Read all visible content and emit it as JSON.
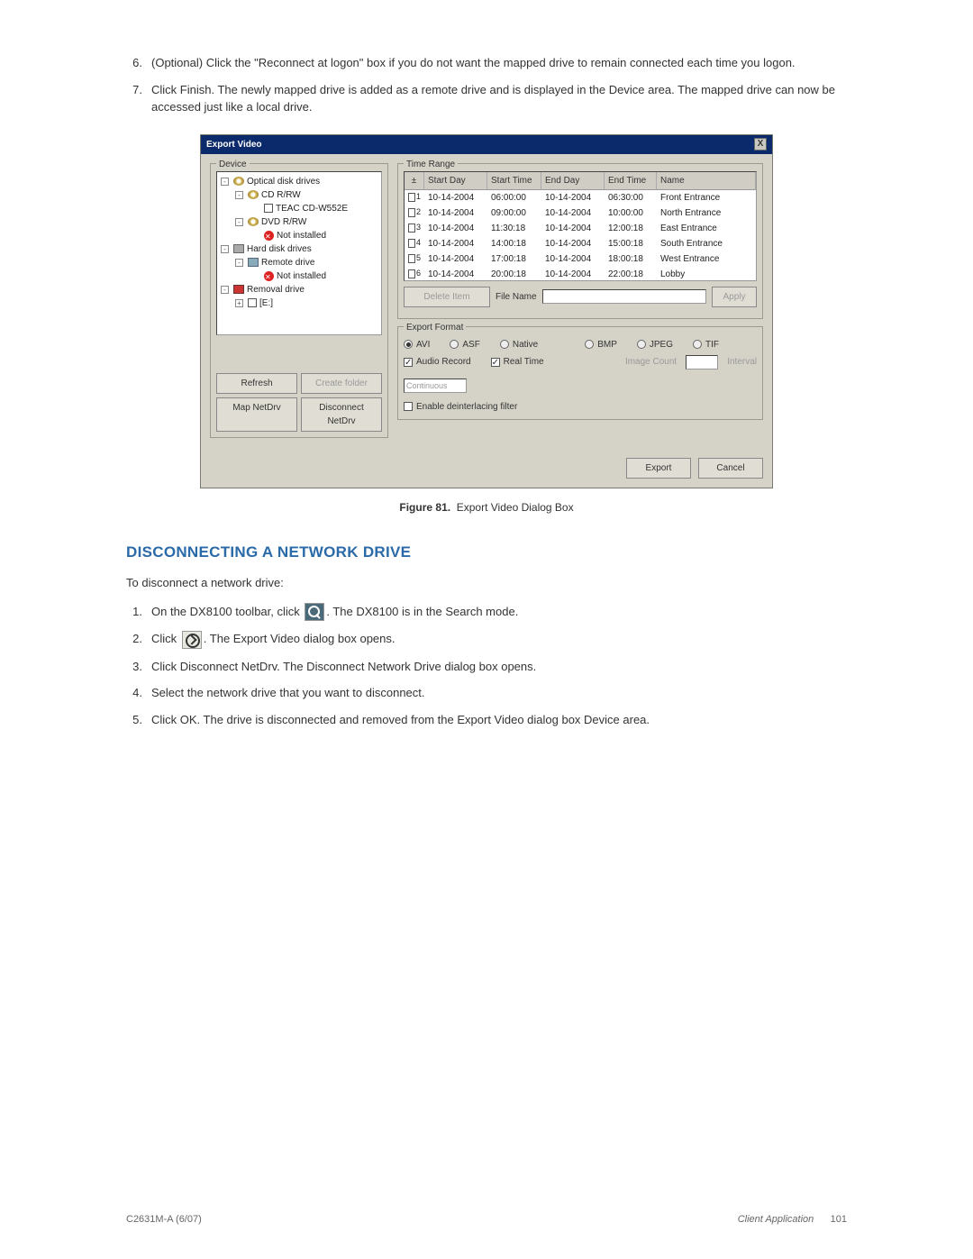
{
  "steps_top": [
    {
      "num": "6.",
      "text": "(Optional) Click the \"Reconnect at logon\" box if you do not want the mapped drive to remain connected each time you logon."
    },
    {
      "num": "7.",
      "text": "Click Finish. The newly mapped drive is added as a remote drive and is displayed in the Device area. The mapped drive can now be accessed just like a local drive."
    }
  ],
  "dialog": {
    "title": "Export Video",
    "device": {
      "legend": "Device",
      "tree": [
        {
          "indent": 0,
          "pm": "-",
          "icon": "cd",
          "label": "Optical disk drives"
        },
        {
          "indent": 1,
          "pm": "-",
          "icon": "cd",
          "label": "CD R/RW"
        },
        {
          "indent": 2,
          "pm": "",
          "icon": "stop",
          "label": "TEAC    CD-W552E"
        },
        {
          "indent": 1,
          "pm": "-",
          "icon": "cd",
          "label": "DVD R/RW"
        },
        {
          "indent": 2,
          "pm": "",
          "icon": "err",
          "label": "Not installed"
        },
        {
          "indent": 0,
          "pm": "-",
          "icon": "hd",
          "label": "Hard disk drives"
        },
        {
          "indent": 1,
          "pm": "-",
          "icon": "remote",
          "label": "Remote drive"
        },
        {
          "indent": 2,
          "pm": "",
          "icon": "err",
          "label": "Not installed"
        },
        {
          "indent": 0,
          "pm": "-",
          "icon": "rm",
          "label": "Removal drive"
        },
        {
          "indent": 1,
          "pm": "+",
          "icon": "stop",
          "label": "[E:]"
        }
      ],
      "buttons": {
        "refresh": "Refresh",
        "create": "Create folder",
        "map": "Map NetDrv",
        "disc": "Disconnect NetDrv"
      }
    },
    "timerange": {
      "legend": "Time Range",
      "headers": {
        "chk": "±",
        "sd": "Start Day",
        "st": "Start Time",
        "ed": "End Day",
        "et": "End Time",
        "nm": "Name"
      },
      "rows": [
        {
          "n": "1",
          "sd": "10-14-2004",
          "st": "06:00:00",
          "ed": "10-14-2004",
          "et": "06:30:00",
          "nm": "Front Entrance"
        },
        {
          "n": "2",
          "sd": "10-14-2004",
          "st": "09:00:00",
          "ed": "10-14-2004",
          "et": "10:00:00",
          "nm": "North Entrance"
        },
        {
          "n": "3",
          "sd": "10-14-2004",
          "st": "11:30:18",
          "ed": "10-14-2004",
          "et": "12:00:18",
          "nm": "East Entrance"
        },
        {
          "n": "4",
          "sd": "10-14-2004",
          "st": "14:00:18",
          "ed": "10-14-2004",
          "et": "15:00:18",
          "nm": "South Entrance"
        },
        {
          "n": "5",
          "sd": "10-14-2004",
          "st": "17:00:18",
          "ed": "10-14-2004",
          "et": "18:00:18",
          "nm": "West Entrance"
        },
        {
          "n": "6",
          "sd": "10-14-2004",
          "st": "20:00:18",
          "ed": "10-14-2004",
          "et": "22:00:18",
          "nm": "Lobby"
        }
      ],
      "delete": "Delete Item",
      "filename": "File Name",
      "apply": "Apply"
    },
    "exportformat": {
      "legend": "Export Format",
      "radios": {
        "avi": "AVI",
        "asf": "ASF",
        "native": "Native",
        "bmp": "BMP",
        "jpeg": "JPEG",
        "tif": "TIF"
      },
      "audio": "Audio Record",
      "realtime": "Real Time",
      "imgcount": "Image Count",
      "interval": "Interval",
      "intervalval": "Continuous",
      "deint": "Enable deinterlacing filter"
    },
    "export": "Export",
    "cancel": "Cancel"
  },
  "figure": {
    "label": "Figure 81.",
    "caption": "Export Video Dialog Box"
  },
  "section": "DISCONNECTING A NETWORK DRIVE",
  "intro": "To disconnect a network drive:",
  "steps_bottom": [
    {
      "num": "1.",
      "pre": "On the DX8100 toolbar, click ",
      "post": ". The DX8100 is in the Search mode.",
      "icon": "search"
    },
    {
      "num": "2.",
      "pre": "Click ",
      "post": ". The Export Video dialog box opens.",
      "icon": "export"
    },
    {
      "num": "3.",
      "text": "Click Disconnect NetDrv. The Disconnect Network Drive dialog box opens."
    },
    {
      "num": "4.",
      "text": "Select the network drive that you want to disconnect."
    },
    {
      "num": "5.",
      "text": "Click OK. The drive is disconnected and removed from the Export Video dialog box Device area."
    }
  ],
  "footer": {
    "left": "C2631M-A (6/07)",
    "right": "Client Application",
    "page": "101"
  }
}
